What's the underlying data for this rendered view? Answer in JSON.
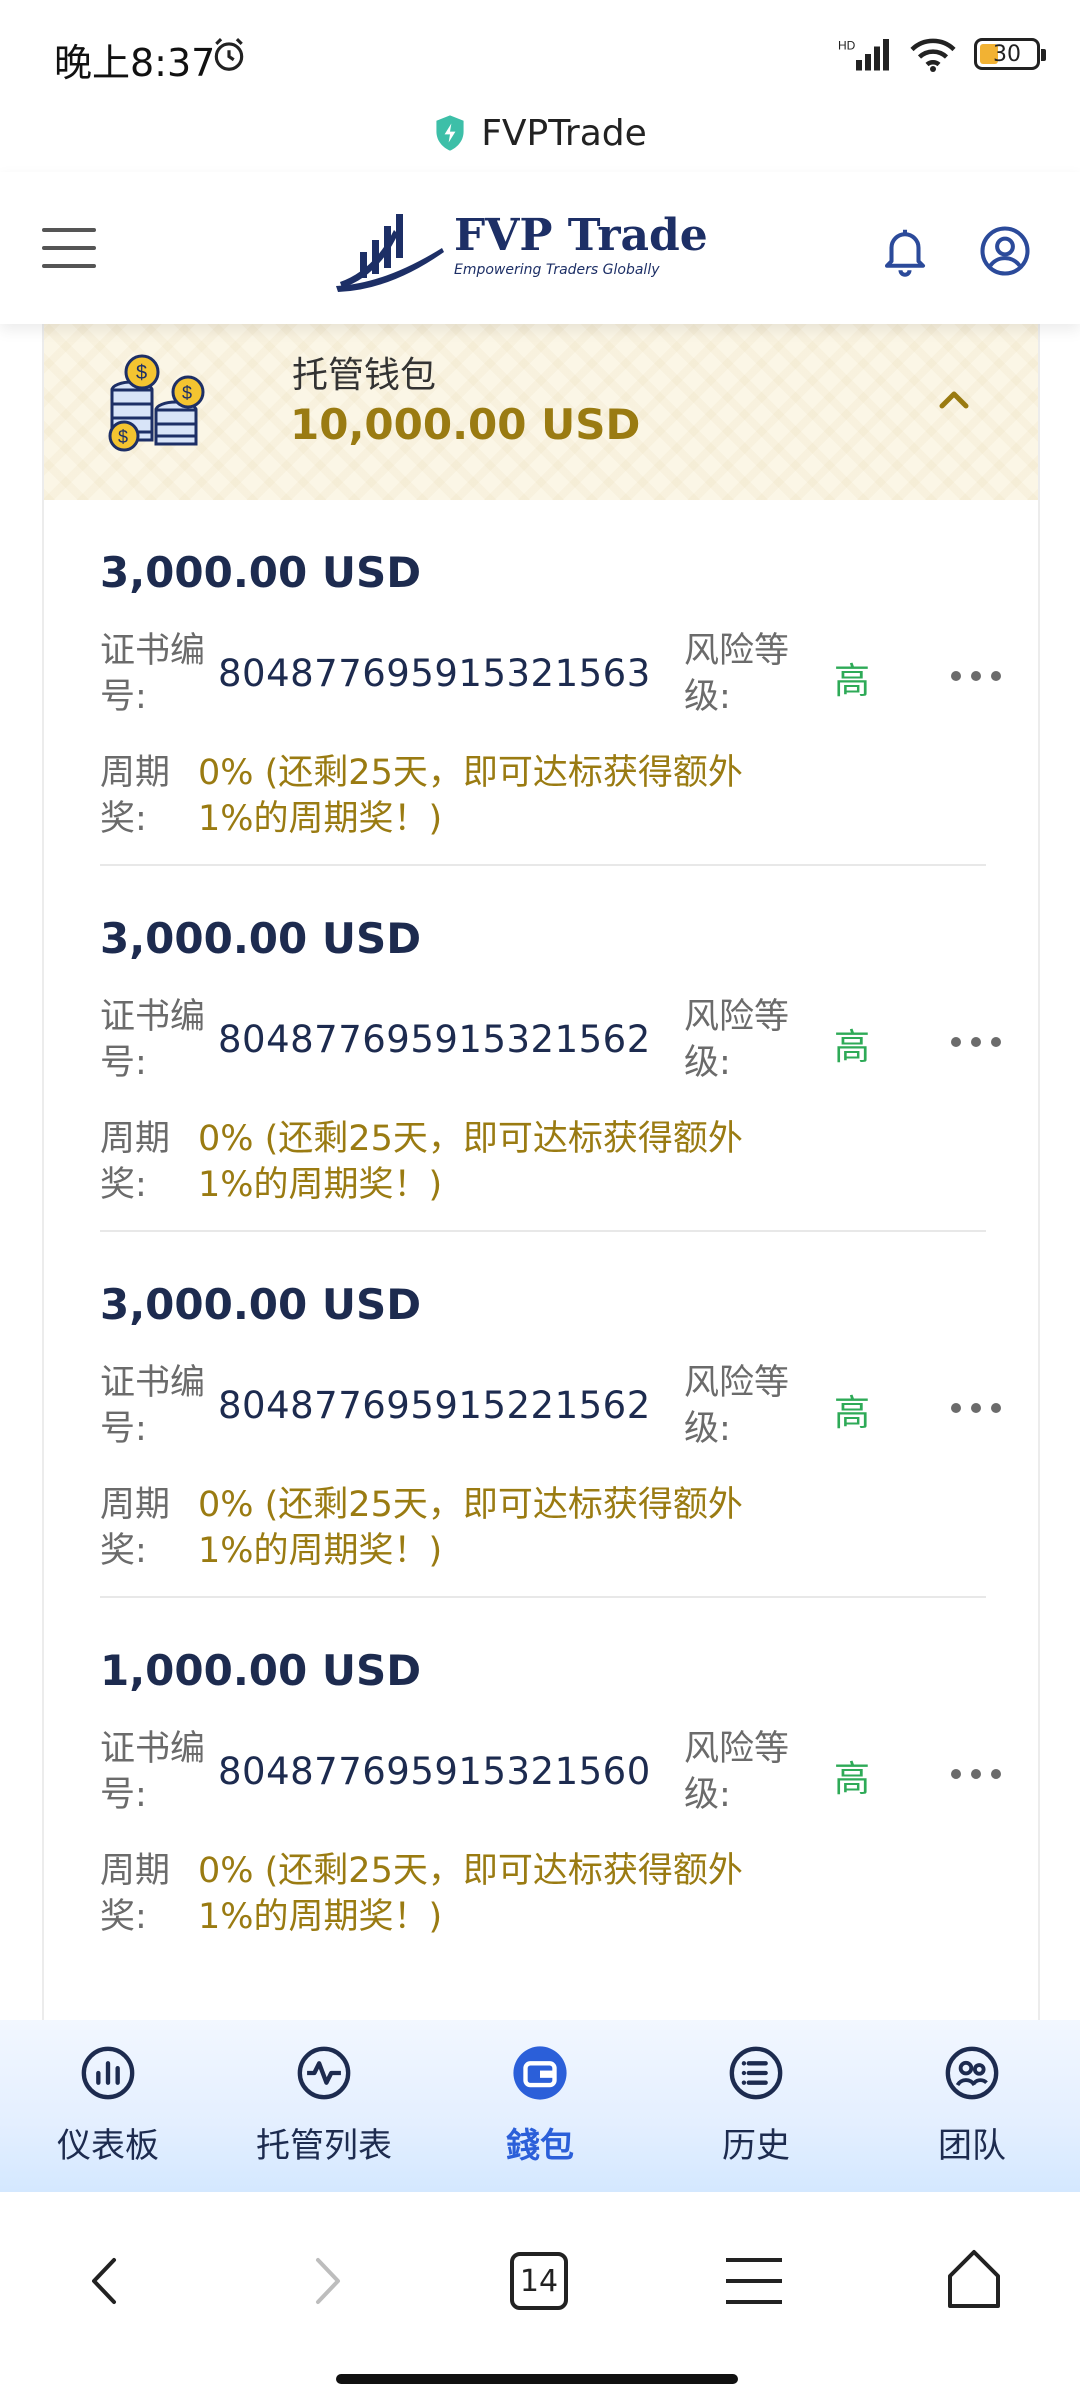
{
  "status_bar": {
    "time": "晚上8:37",
    "battery": "30"
  },
  "browser": {
    "site_title": "FVPTrade",
    "tab_count": "14"
  },
  "header": {
    "brand": "FVP Trade",
    "tagline": "Empowering Traders Globally"
  },
  "wallet": {
    "title": "托管钱包",
    "amount": "10,000.00 USD"
  },
  "certificates": [
    {
      "amount": "3,000.00 USD",
      "cert_label": "证书编号:",
      "cert_no": "804877695915321563",
      "risk_label": "风险等级:",
      "risk": "高",
      "bonus_label": "周期奖:",
      "bonus": "0% (还剩25天，即可达标获得额外1%的周期奖！)"
    },
    {
      "amount": "3,000.00 USD",
      "cert_label": "证书编号:",
      "cert_no": "804877695915321562",
      "risk_label": "风险等级:",
      "risk": "高",
      "bonus_label": "周期奖:",
      "bonus": "0% (还剩25天，即可达标获得额外1%的周期奖！)"
    },
    {
      "amount": "3,000.00 USD",
      "cert_label": "证书编号:",
      "cert_no": "804877695915221562",
      "risk_label": "风险等级:",
      "risk": "高",
      "bonus_label": "周期奖:",
      "bonus": "0% (还剩25天，即可达标获得额外1%的周期奖！)"
    },
    {
      "amount": "1,000.00 USD",
      "cert_label": "证书编号:",
      "cert_no": "804877695915321560",
      "risk_label": "风险等级:",
      "risk": "高",
      "bonus_label": "周期奖:",
      "bonus": "0% (还剩25天，即可达标获得额外1%的周期奖！)"
    }
  ],
  "tabs": [
    {
      "label": "仪表板",
      "icon": "dashboard-icon"
    },
    {
      "label": "托管列表",
      "icon": "pulse-icon"
    },
    {
      "label": "錢包",
      "icon": "wallet-icon",
      "active": true
    },
    {
      "label": "历史",
      "icon": "list-icon"
    },
    {
      "label": "团队",
      "icon": "team-icon"
    }
  ],
  "colors": {
    "navy": "#1d2b4f",
    "gold": "#9a7b12",
    "risk_green": "#2eaa57",
    "active_blue": "#2b5fd9"
  }
}
